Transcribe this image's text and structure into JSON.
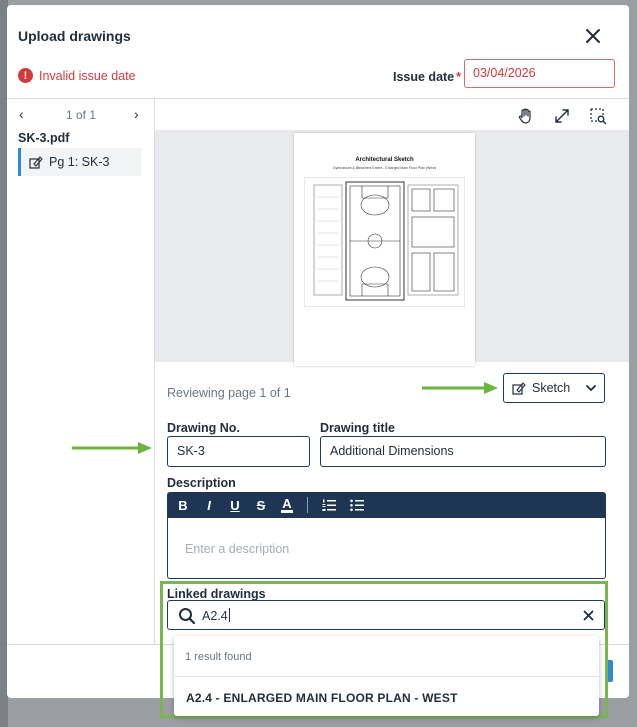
{
  "modal": {
    "title": "Upload drawings",
    "error": "Invalid issue date",
    "issue_date_label": "Issue date",
    "required_mark": "*",
    "issue_date_value": "03/04/2026"
  },
  "left_panel": {
    "prev": "‹",
    "next": "›",
    "pager_text": "1 of 1",
    "file_name": "SK-3.pdf",
    "page_item": "Pg 1: SK-3"
  },
  "preview": {
    "sheet_title": "Architectural Sketch",
    "sheet_subtitle": "Gymnasium & Bleachers Extent - Enlarged Main Floor Plan (West)",
    "reviewing_text": "Reviewing page 1 of 1",
    "discipline": "Sketch",
    "tools": [
      "hand-icon",
      "expand-icon",
      "zoom-area-icon"
    ]
  },
  "form": {
    "drawing_no_label": "Drawing No.",
    "drawing_no_value": "SK-3",
    "drawing_title_label": "Drawing title",
    "drawing_title_value": "Additional Dimensions",
    "description_label": "Description",
    "description_placeholder": "Enter a description",
    "toolbar": [
      "B",
      "I",
      "U",
      "S",
      "A"
    ]
  },
  "linked": {
    "label": "Linked drawings",
    "search_value": "A2.4",
    "result_count": "1 result found",
    "result_item": "A2.4 - ENLARGED MAIN FLOOR PLAN - WEST"
  },
  "colors": {
    "accent": "#2d8ad6",
    "error": "#d43a3a",
    "navy": "#1e3654",
    "highlight": "#7ab650"
  }
}
